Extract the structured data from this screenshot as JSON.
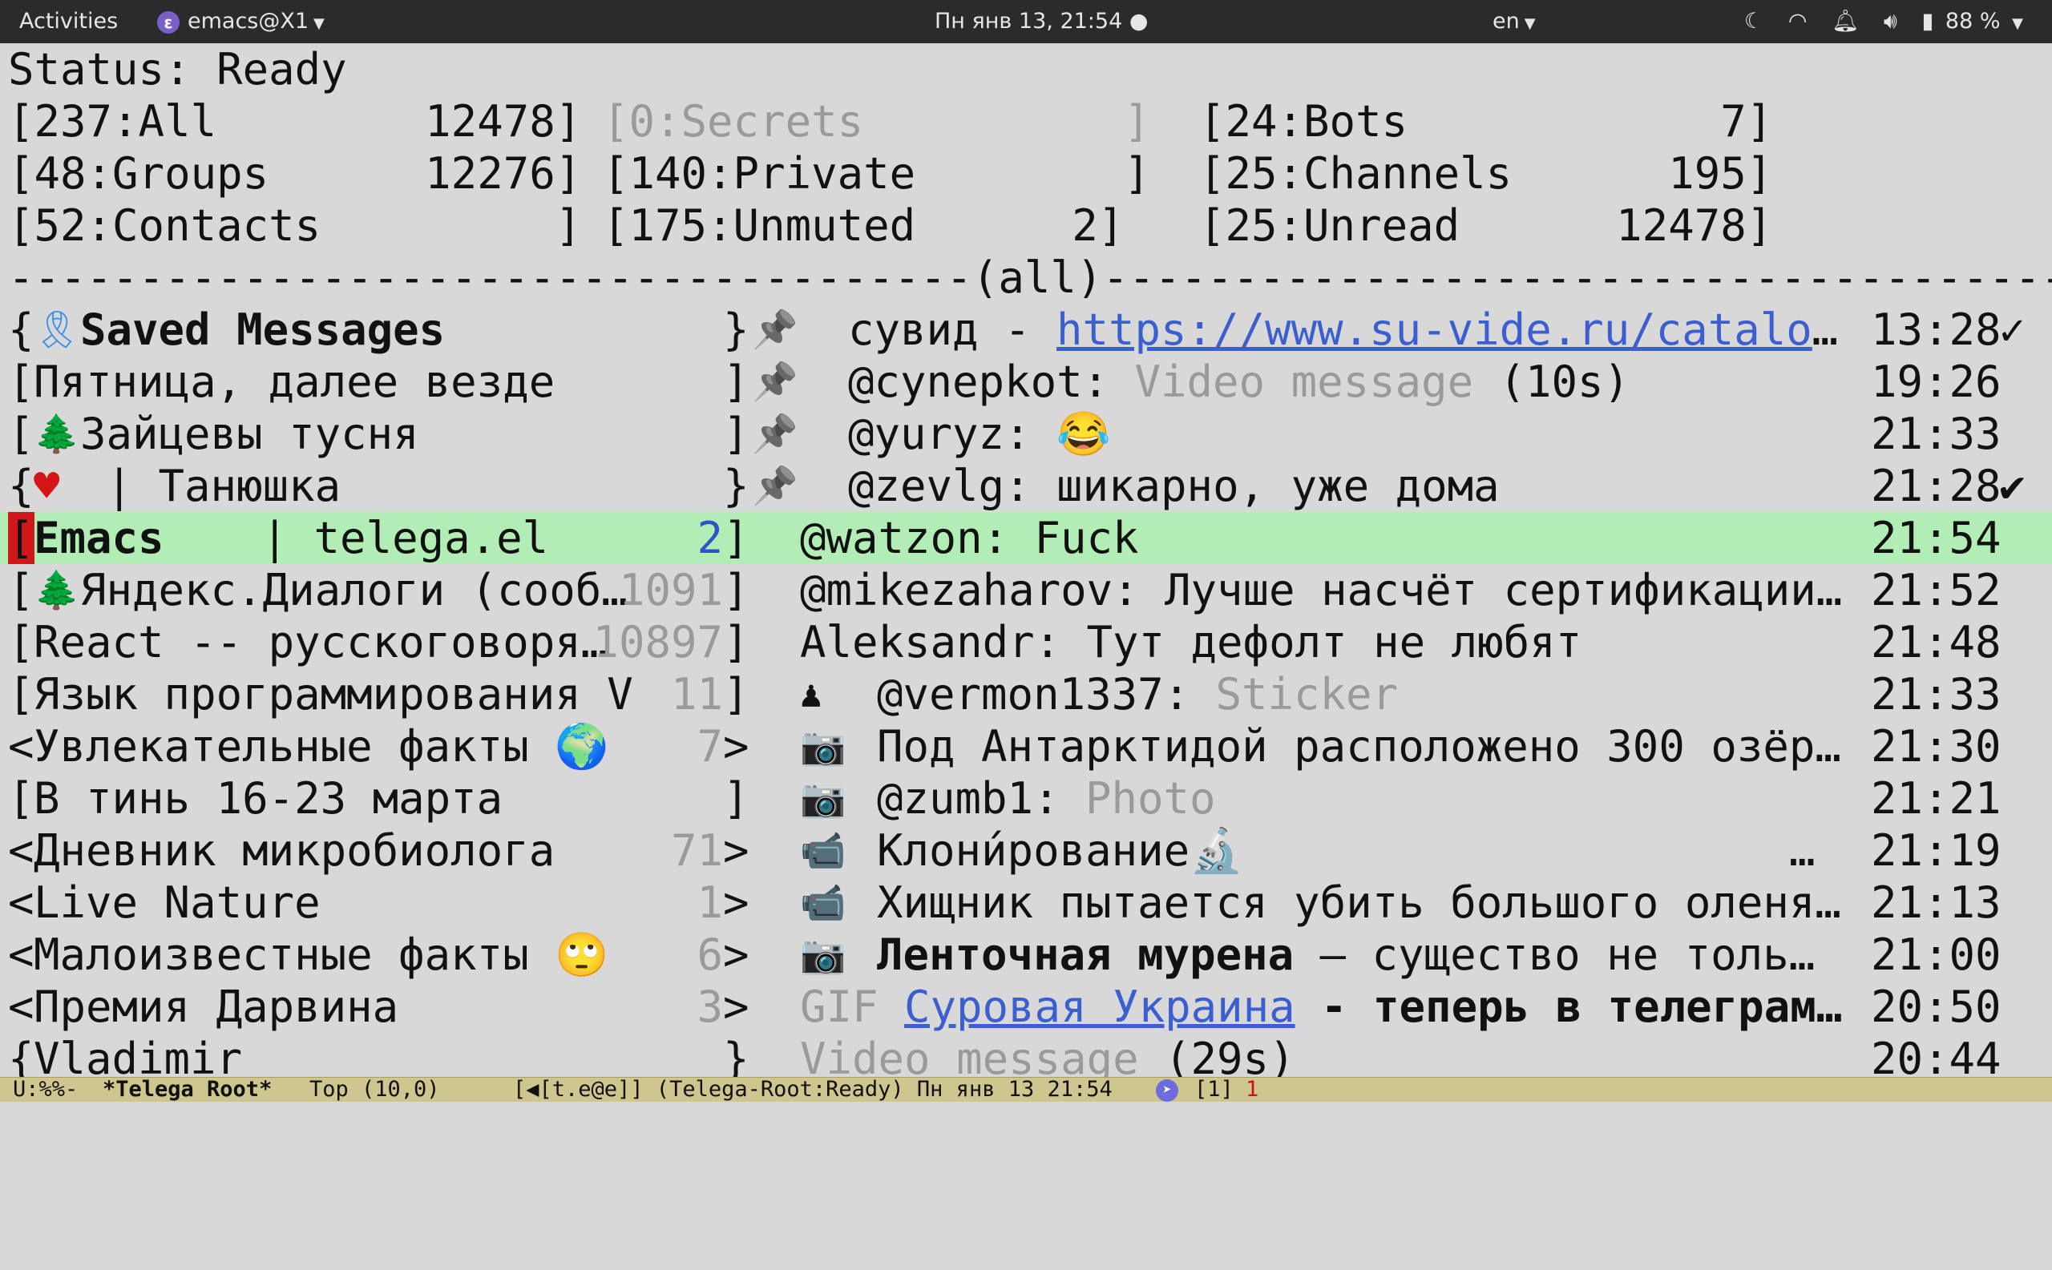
{
  "topbar": {
    "activities": "Activities",
    "app_name": "emacs@X1",
    "clock": "Пн янв 13, 21:54 ●",
    "keyboard_layout": "en",
    "battery": "88 %",
    "icons": [
      "moon-icon",
      "wifi-icon",
      "notification-icon",
      "volume-icon",
      "battery-icon",
      "chevron-down-icon"
    ]
  },
  "status": "Status: Ready",
  "filters": [
    [
      "[237:All        12478]",
      "[0:Secrets          ]",
      "[24:Bots            7]"
    ],
    [
      "[48:Groups      12276]",
      "[140:Private        ]",
      "[25:Channels      195]"
    ],
    [
      "[52:Contacts         ]",
      "[175:Unmuted      2]",
      "[25:Unread      12478]"
    ]
  ],
  "separator": "-------------------------------------(all)-------------------------------------",
  "chats": [
    {
      "open": "{",
      "icon": "🎗",
      "title": "Saved Messages",
      "count": "",
      "close": "}",
      "pin": "📌",
      "last_sender": "сувид - ",
      "last_link": "https://www.su-vide.ru/catalo",
      "last_rest": "…",
      "time": "13:28",
      "check": "✓"
    },
    {
      "open": "[",
      "icon": "",
      "title": "Пятница, далее везде",
      "count": "",
      "close": "]",
      "pin": "📌",
      "last_sender": "@cynepkot: ",
      "last_dim": "Video message",
      "last_rest": " (10s)",
      "time": "19:26",
      "check": ""
    },
    {
      "open": "[",
      "icon": "🌲",
      "title": "Зайцевы тусня",
      "count": "",
      "close": "]",
      "pin": "📌",
      "last_sender": "@yuryz: ",
      "last_rest": "😂",
      "time": "21:33",
      "check": ""
    },
    {
      "open": "{",
      "icon": "♥",
      "title": " | Танюшка",
      "count": "",
      "close": "}",
      "pin": "📌",
      "last_sender": "@zevlg: ",
      "last_rest": "шикарно, уже дома",
      "time": "21:28",
      "check": "✔"
    },
    {
      "open": "[",
      "icon": "",
      "title": "Emacs",
      "title2": " | telega.el",
      "count": "2",
      "close": "]",
      "pin": "",
      "last_sender": "@watzon: ",
      "last_rest": "Fuck",
      "time": "21:54",
      "check": ""
    },
    {
      "open": "[",
      "icon": "🌲",
      "title": "Яндекс.Диалоги (сооб…",
      "count": "1091",
      "close": "]",
      "pin": "",
      "last_sender": "@mikezaharov: ",
      "last_rest": "Лучше насчёт сертификации…",
      "time": "21:52",
      "check": ""
    },
    {
      "open": "[",
      "icon": "",
      "title": "React -- русскоговоря…",
      "count": "10897",
      "close": "]",
      "pin": "",
      "last_sender": "Aleksandr: ",
      "last_rest": "Тут дефолт не любят",
      "time": "21:48",
      "check": ""
    },
    {
      "open": "[",
      "icon": "",
      "title": "Язык программирования V",
      "count": "11",
      "close": "]",
      "pin": "",
      "last_sender": "@vermon1337: ",
      "last_icon": "♟ ",
      "last_dim": "Sticker",
      "time": "21:33",
      "check": ""
    },
    {
      "open": "<",
      "icon": "",
      "title": "Увлекательные факты 🌍",
      "count": "7",
      "close": ">",
      "pin": "",
      "last_icon": "📷 ",
      "last_rest": "Под Антарктидой расположено 300 озёр…",
      "time": "21:30",
      "check": ""
    },
    {
      "open": "[",
      "icon": "",
      "title": "В тинь 16-23 марта",
      "count": "",
      "close": "]",
      "pin": "",
      "last_sender": "@zumb1: ",
      "last_icon": "📷 ",
      "last_dim": "Photo",
      "time": "21:21",
      "check": ""
    },
    {
      "open": "<",
      "icon": "",
      "title": "Дневник микробиолога",
      "count": "71",
      "close": ">",
      "pin": "",
      "last_icon": "📹 ",
      "last_rest": "Клони́рование🔬",
      "last_tail": "…",
      "time": "21:19",
      "check": ""
    },
    {
      "open": "<",
      "icon": "",
      "title": "Live Nature",
      "count": "1",
      "close": ">",
      "pin": "",
      "last_icon": "📹 ",
      "last_rest": "Хищник пытается убить большого оленя…",
      "time": "21:13",
      "check": ""
    },
    {
      "open": "<",
      "icon": "",
      "title": "Малоизвестные факты 🙄",
      "count": "6",
      "close": ">",
      "pin": "",
      "last_icon": "📷 ",
      "last_bold": "Ленточная мурена",
      "last_rest": " – существо не толь…",
      "time": "21:00",
      "check": ""
    },
    {
      "open": "<",
      "icon": "",
      "title": "Премия Дарвина",
      "count": "3",
      "close": ">",
      "pin": "",
      "last_dim": "GIF ",
      "last_link": "Суровая Украина",
      "last_bold": " - теперь в телеграм…",
      "time": "20:50",
      "check": ""
    },
    {
      "open": "{",
      "icon": "",
      "title": "Vladimir",
      "count": "",
      "close": "}",
      "pin": "",
      "last_dim": "Video message",
      "last_rest": " (29s)",
      "time": "20:44",
      "check": ""
    }
  ],
  "modeline": {
    "state": "U:%%-",
    "buffer_name": "*Telega Root*",
    "position": "Top (10,0)",
    "mode_prefix": "[◀[t.e@e]] (Telega-Root:Ready) Пн янв 13 21:54",
    "tg_icon": "telegram-icon",
    "tg_count": "[1]",
    "unread": "1"
  },
  "colors": {
    "buffer_bg": "#d8d8d8",
    "highlight_bg": "#b1edb4",
    "link": "#3b5fd0",
    "modeline_bg": "#cfc68f",
    "topbar_bg": "#2b2b2b"
  }
}
